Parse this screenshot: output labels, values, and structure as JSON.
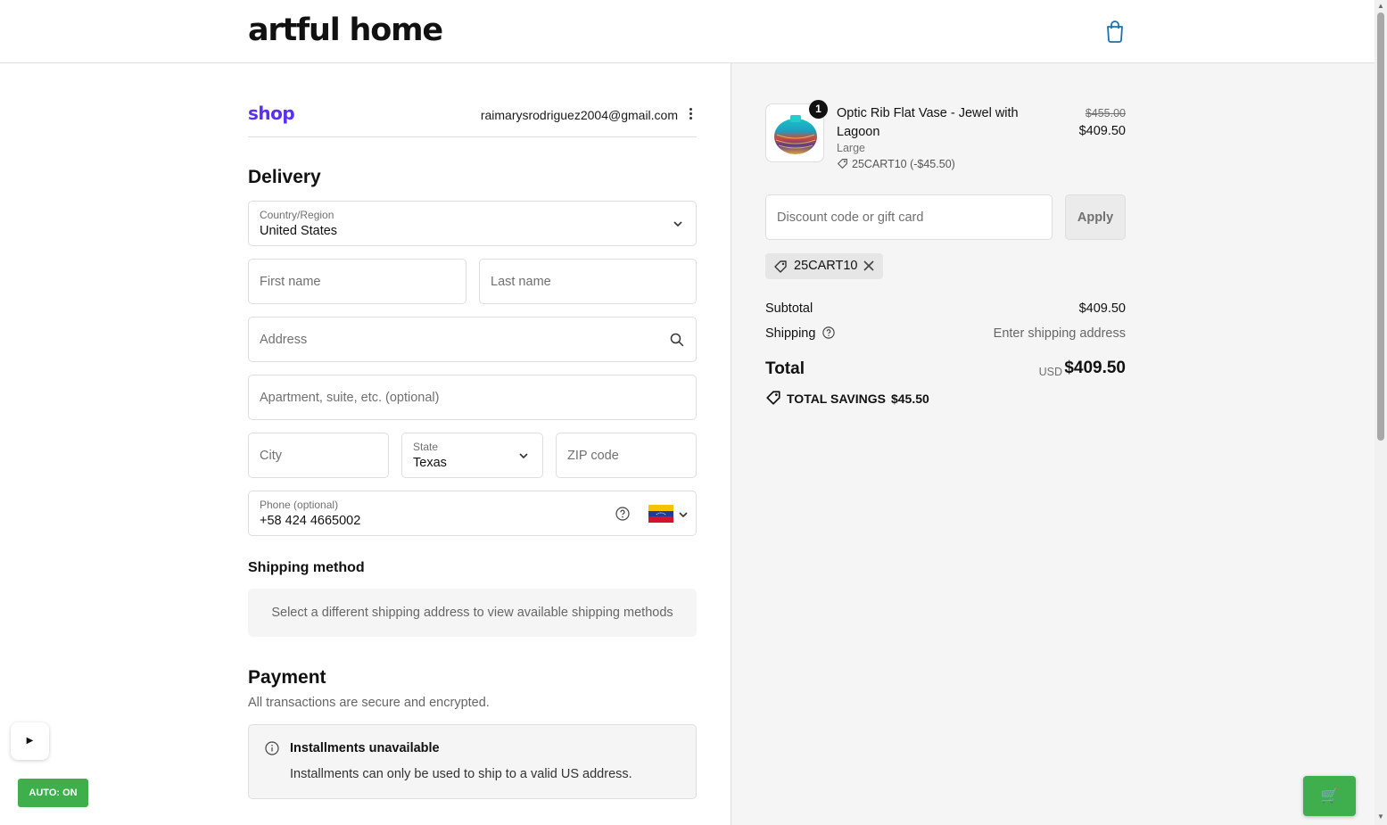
{
  "header": {
    "logo": "artful home",
    "bag_icon": "shopping-bag-icon"
  },
  "shop_account": {
    "logo": "shop",
    "email": "raimarysrodriguez2004@gmail.com",
    "menu_icon": "more-vertical-icon"
  },
  "delivery": {
    "title": "Delivery",
    "country": {
      "label": "Country/Region",
      "value": "United States"
    },
    "first_name": {
      "placeholder": "First name",
      "value": ""
    },
    "last_name": {
      "placeholder": "Last name",
      "value": ""
    },
    "address": {
      "placeholder": "Address",
      "value": ""
    },
    "apartment": {
      "placeholder": "Apartment, suite, etc. (optional)",
      "value": ""
    },
    "city": {
      "placeholder": "City",
      "value": ""
    },
    "state": {
      "label": "State",
      "value": "Texas"
    },
    "zip": {
      "placeholder": "ZIP code",
      "value": ""
    },
    "phone": {
      "label": "Phone (optional)",
      "value": "+58 424 4665002",
      "flag": "venezuela-flag"
    }
  },
  "shipping_method": {
    "title": "Shipping method",
    "message": "Select a different shipping address to view available shipping methods"
  },
  "payment": {
    "title": "Payment",
    "subtitle": "All transactions are secure and encrypted.",
    "installments_title": "Installments unavailable",
    "installments_text": "Installments can only be used to ship to a valid US address."
  },
  "widgets": {
    "play_label": "▶",
    "auto_label": "AUTO: ON",
    "cart_icon": "🛒"
  },
  "order_summary": {
    "item": {
      "quantity": "1",
      "name": "Optic Rib Flat Vase - Jewel with Lagoon",
      "variant": "Large",
      "discount": "25CART10 (-$45.50)",
      "original_price": "$455.00",
      "price": "$409.50"
    },
    "discount_field": {
      "placeholder": "Discount code or gift card"
    },
    "apply_label": "Apply",
    "applied_code": "25CART10",
    "subtotal_label": "Subtotal",
    "subtotal_value": "$409.50",
    "shipping_label": "Shipping",
    "shipping_value": "Enter shipping address",
    "total_label": "Total",
    "currency": "USD",
    "total_value": "$409.50",
    "savings_label": "TOTAL SAVINGS",
    "savings_value": "$45.50"
  },
  "colors": {
    "shop_purple": "#5a31f4",
    "accent_blue": "#1773b0",
    "green": "#3fae4c",
    "summary_bg": "#f5f5f5"
  }
}
